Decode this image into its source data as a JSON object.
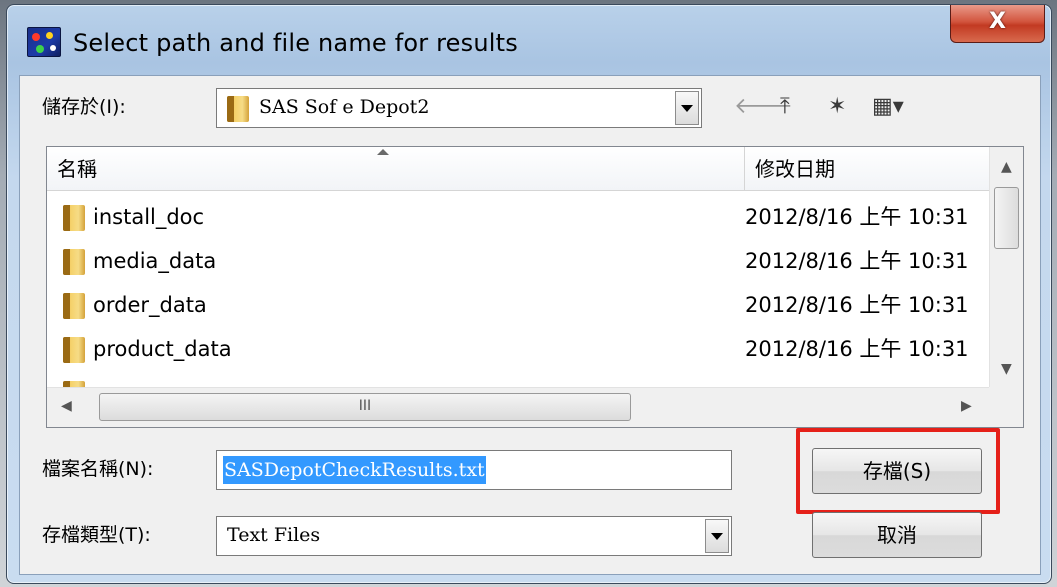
{
  "window": {
    "title": "Select path and file name for results",
    "close_glyph": "X"
  },
  "save_in": {
    "label": "儲存於(I):",
    "value": "SAS Sof      e Depot2"
  },
  "toolbar": {
    "back_glyph": "🡐",
    "up_glyph": "⤒",
    "newfolder_glyph": "✶",
    "view_glyph": "▦▾"
  },
  "file_list": {
    "columns": {
      "name": "名稱",
      "modified": "修改日期"
    },
    "rows": [
      {
        "name": "install_doc",
        "date": "2012/8/16 上午 10:31"
      },
      {
        "name": "media_data",
        "date": "2012/8/16 上午 10:31"
      },
      {
        "name": "order_data",
        "date": "2012/8/16 上午 10:31"
      },
      {
        "name": "product_data",
        "date": "2012/8/16 上午 10:31"
      }
    ],
    "hscroll_thumb_glyph": "III"
  },
  "file_name": {
    "label": "檔案名稱(N):",
    "value": "SASDepotCheckResults.txt"
  },
  "file_type": {
    "label": "存檔類型(T):",
    "value": "Text Files"
  },
  "buttons": {
    "save": "存檔(S)",
    "cancel": "取消"
  },
  "colors": {
    "highlight": "#e52019",
    "selection": "#3399ff"
  }
}
